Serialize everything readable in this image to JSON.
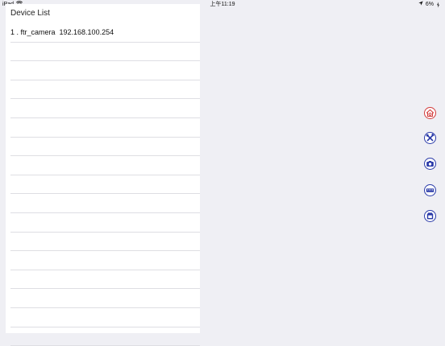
{
  "status_bar": {
    "device": "iPad",
    "time": "上午11:19",
    "battery": "6%",
    "icons": [
      "wifi-icon",
      "location-arrow-icon",
      "battery-icon"
    ]
  },
  "device_panel": {
    "title": "Device List",
    "items": [
      "1 . ftr_camera  192.168.100.254",
      "",
      "",
      "",
      "",
      "",
      "",
      "",
      "",
      "",
      "",
      "",
      "",
      "",
      "",
      "",
      ""
    ]
  },
  "toolbar": {
    "buttons": [
      {
        "icon": "home-gear-icon",
        "color": "#d23a3a"
      },
      {
        "icon": "tools-icon",
        "color": "#2a3aa8"
      },
      {
        "icon": "camera-icon",
        "color": "#2a3aa8"
      },
      {
        "icon": "video-icon",
        "color": "#2a3aa8"
      },
      {
        "icon": "card-icon",
        "color": "#2a3aa8"
      }
    ]
  }
}
